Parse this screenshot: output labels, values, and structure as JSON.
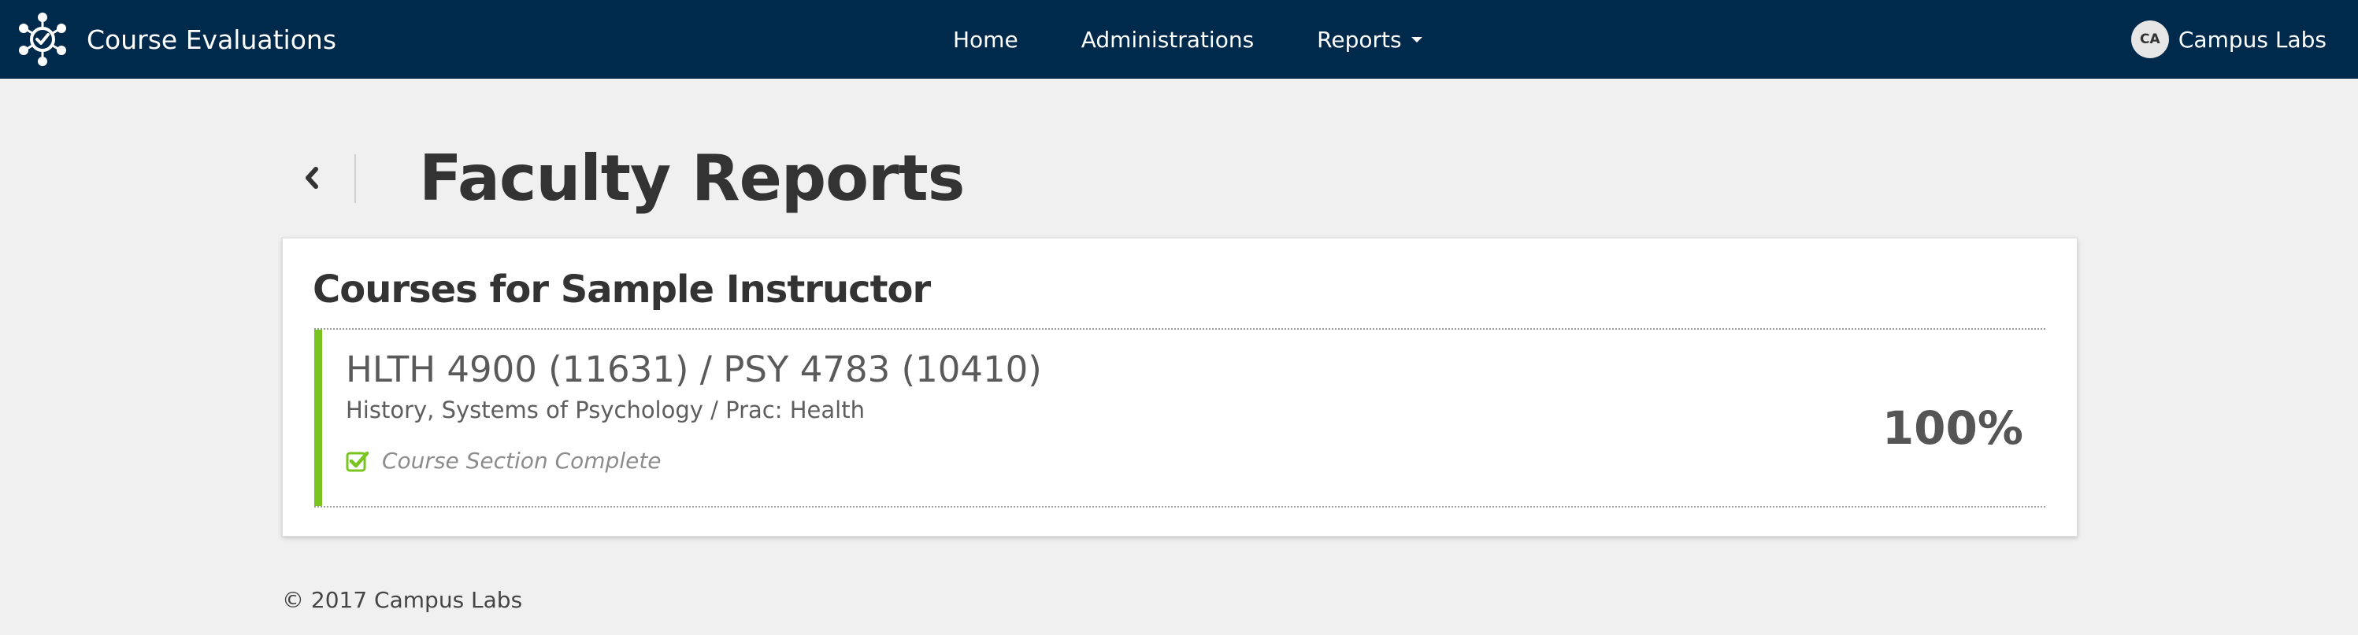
{
  "app": {
    "title": "Course Evaluations",
    "logo_icon": "network-check-logo-icon"
  },
  "nav": {
    "items": [
      {
        "label": "Home"
      },
      {
        "label": "Administrations"
      },
      {
        "label": "Reports",
        "has_dropdown": true
      }
    ]
  },
  "user": {
    "initials": "CA",
    "name": "Campus Labs"
  },
  "page": {
    "title": "Faculty Reports",
    "back_icon": "chevron-left-icon"
  },
  "card": {
    "title": "Courses for Sample Instructor",
    "courses": [
      {
        "code": "HLTH 4900 (11631) / PSY 4783 (10410)",
        "name": "History, Systems of Psychology / Prac: Health",
        "status": "Course Section Complete",
        "status_icon": "checkbox-checked-icon",
        "percent": "100%"
      }
    ]
  },
  "footer": {
    "text": "© 2017 Campus Labs"
  },
  "colors": {
    "navbar_bg": "#002a4b",
    "page_bg": "#f0f0f0",
    "complete_accent": "#7ac41f",
    "text_dark": "#333333"
  }
}
